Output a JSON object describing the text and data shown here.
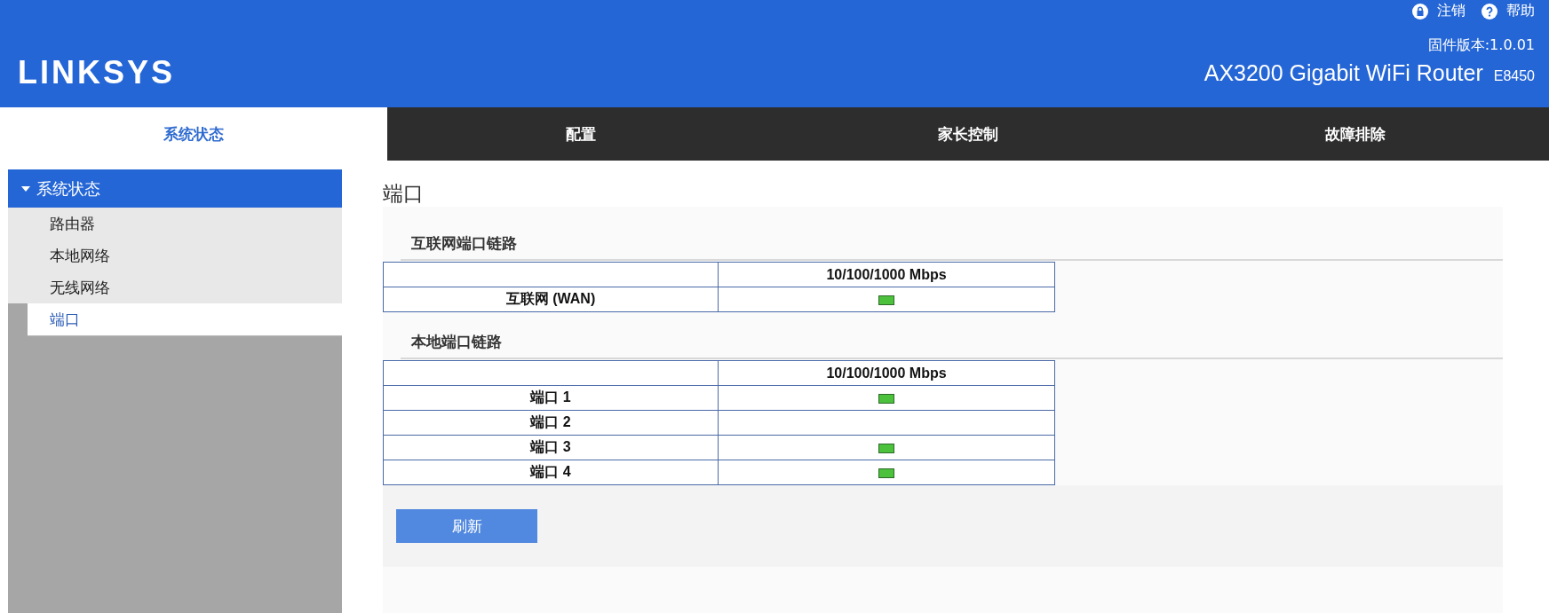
{
  "header": {
    "logo": "LINKSYS",
    "links": [
      {
        "label": "注销",
        "kind": "lock"
      },
      {
        "label": "帮助",
        "kind": "help"
      }
    ],
    "firmware": "固件版本:1.0.01",
    "model": "AX3200 Gigabit WiFi Router",
    "model_code": "E8450"
  },
  "tabs": [
    {
      "label": "系统状态",
      "selected": true
    },
    {
      "label": "配置",
      "selected": false
    },
    {
      "label": "家长控制",
      "selected": false
    },
    {
      "label": "故障排除",
      "selected": false
    }
  ],
  "sidebar": {
    "group": {
      "label": "系统状态",
      "expanded": true
    },
    "items": [
      {
        "label": "路由器",
        "selected": false
      },
      {
        "label": "本地网络",
        "selected": false
      },
      {
        "label": "无线网络",
        "selected": false
      },
      {
        "label": "端口",
        "selected": true
      }
    ]
  },
  "page_title": "端口",
  "sections": [
    {
      "title": "互联网端口链路",
      "columns": [
        "10/100/1000 Mbps"
      ],
      "rows": [
        {
          "name": "互联网 (WAN)",
          "link": true
        }
      ]
    },
    {
      "title": "本地端口链路",
      "columns": [
        "10/100/1000 Mbps"
      ],
      "rows": [
        {
          "name": "端口 1",
          "link": true
        },
        {
          "name": "端口 2",
          "link": false
        },
        {
          "name": "端口 3",
          "link": true
        },
        {
          "name": "端口 4",
          "link": true
        }
      ]
    }
  ],
  "refresh_button": "刷新"
}
